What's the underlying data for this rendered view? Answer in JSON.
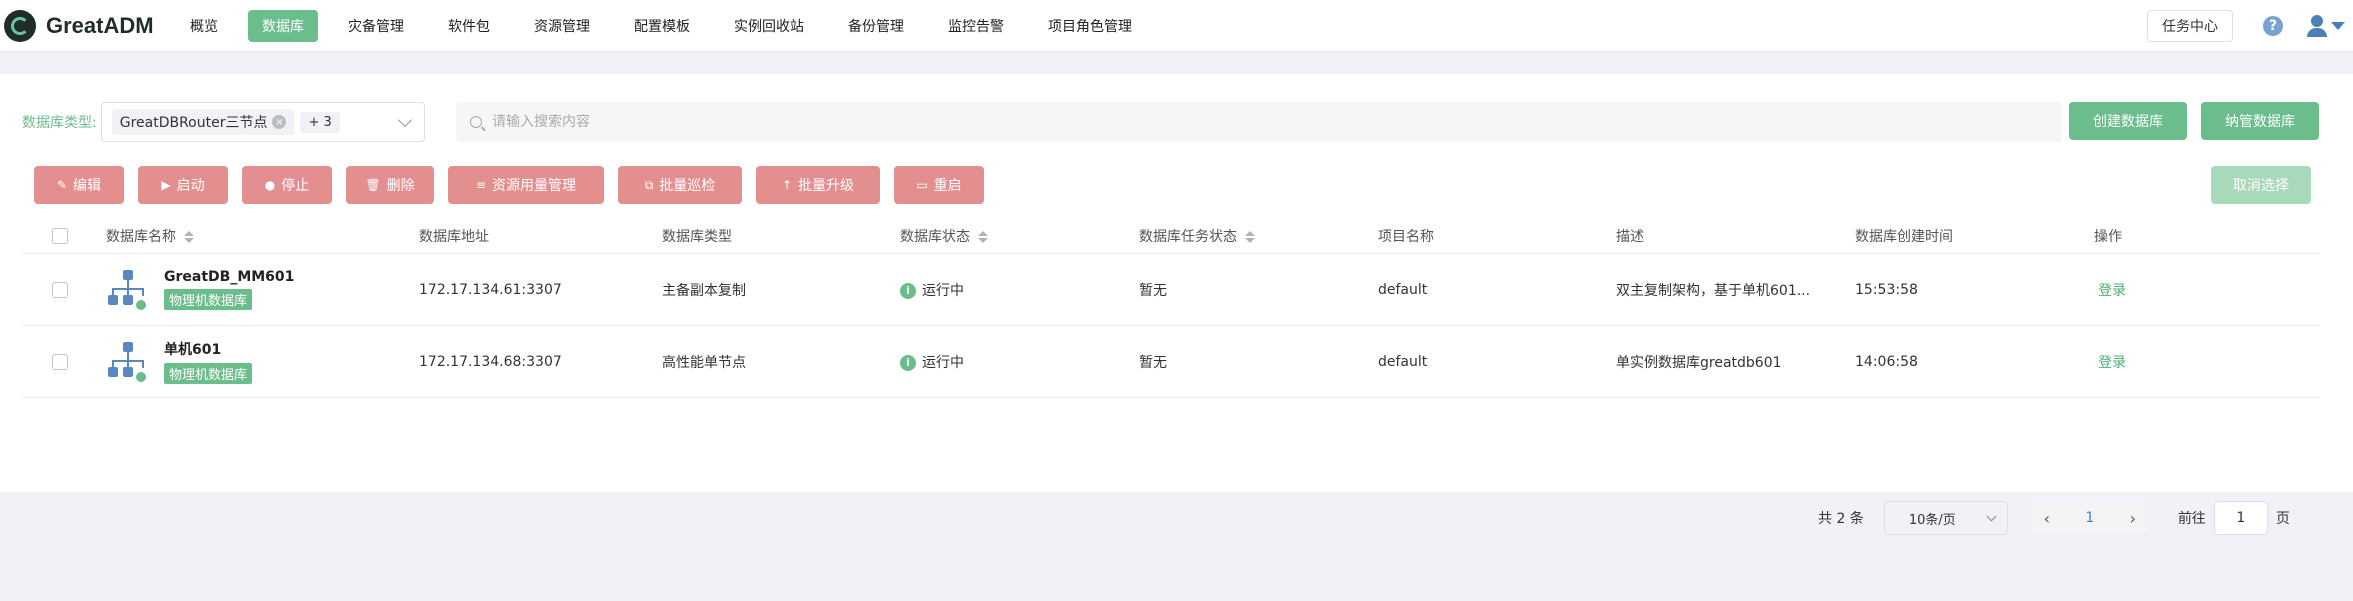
{
  "app": {
    "name": "GreatADM"
  },
  "nav": [
    {
      "label": "概览",
      "active": false
    },
    {
      "label": "数据库",
      "active": true
    },
    {
      "label": "灾备管理",
      "active": false
    },
    {
      "label": "软件包",
      "active": false
    },
    {
      "label": "资源管理",
      "active": false
    },
    {
      "label": "配置模板",
      "active": false
    },
    {
      "label": "实例回收站",
      "active": false
    },
    {
      "label": "备份管理",
      "active": false
    },
    {
      "label": "监控告警",
      "active": false
    },
    {
      "label": "项目角色管理",
      "active": false
    }
  ],
  "topright": {
    "task_center": "任务中心",
    "help_icon": "question-circle-icon",
    "user_icon": "user-icon"
  },
  "filter": {
    "label": "数据库类型:",
    "selected_tag": "GreatDBRouter三节点",
    "more_tag": "+ 3",
    "search_placeholder": "请输入搜索内容"
  },
  "buttons": {
    "create": "创建数据库",
    "adopt": "纳管数据库",
    "cancel_select": "取消选择",
    "actions": [
      {
        "label": "编辑",
        "icon": "edit-icon",
        "glyph": "✎"
      },
      {
        "label": "启动",
        "icon": "play-icon",
        "glyph": "▶"
      },
      {
        "label": "停止",
        "icon": "stop-icon",
        "glyph": "●"
      },
      {
        "label": "删除",
        "icon": "trash-icon",
        "glyph": "🗑"
      },
      {
        "label": "资源用量管理",
        "icon": "list-icon",
        "glyph": "≡"
      },
      {
        "label": "批量巡检",
        "icon": "copy-icon",
        "glyph": "⧉"
      },
      {
        "label": "批量升级",
        "icon": "arrow-up-icon",
        "glyph": "↑"
      },
      {
        "label": "重启",
        "icon": "restart-icon",
        "glyph": "▭"
      }
    ]
  },
  "table": {
    "columns": [
      "数据库名称",
      "数据库地址",
      "数据库类型",
      "数据库状态",
      "数据库任务状态",
      "项目名称",
      "描述",
      "数据库创建时间",
      "操作"
    ],
    "rows": [
      {
        "name": "GreatDB_MM601",
        "badge": "物理机数据库",
        "address": "172.17.134.61:3307",
        "type": "主备副本复制",
        "status": "运行中",
        "task_status": "暂无",
        "project": "default",
        "description": "双主复制架构，基于单机601...",
        "created": "15:53:58",
        "action": "登录"
      },
      {
        "name": "单机601",
        "badge": "物理机数据库",
        "address": "172.17.134.68:3307",
        "type": "高性能单节点",
        "status": "运行中",
        "task_status": "暂无",
        "project": "default",
        "description": "单实例数据库greatdb601",
        "created": "14:06:58",
        "action": "登录"
      }
    ]
  },
  "pagination": {
    "total": "共 2 条",
    "page_size": "10条/页",
    "current_page": "1",
    "goto_label": "前往",
    "goto_value": "1",
    "page_suffix": "页"
  },
  "colors": {
    "accent": "#6cbd8c",
    "danger": "#e48f8f",
    "link": "#4a7fd0"
  }
}
